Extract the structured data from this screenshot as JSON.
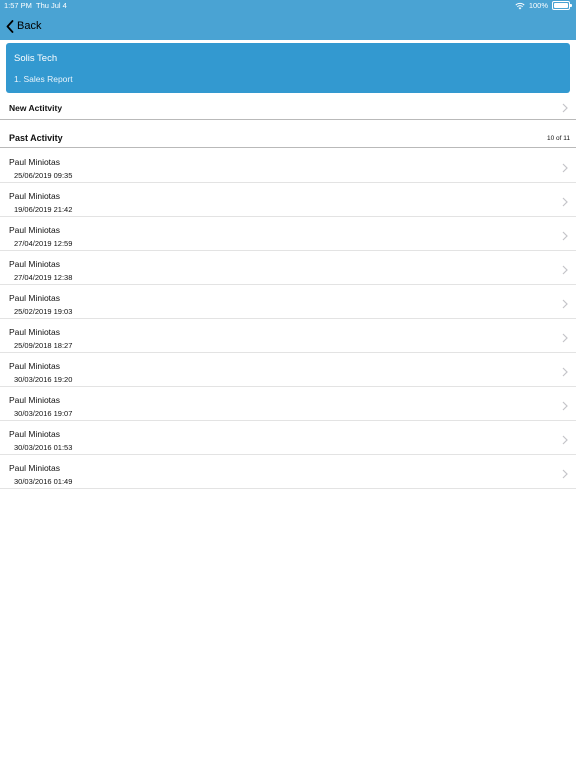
{
  "status_bar": {
    "time": "1:57 PM",
    "date": "Thu Jul 4",
    "battery": "100%"
  },
  "nav": {
    "back_label": "Back"
  },
  "header": {
    "company": "Solis Tech",
    "report": "1. Sales Report"
  },
  "new_activity": {
    "label": "New Actitvity"
  },
  "past_activity": {
    "label": "Past Activity",
    "count": "10 of 11"
  },
  "activities": [
    {
      "name": "Paul Miniotas",
      "date": "25/06/2019 09:35"
    },
    {
      "name": "Paul Miniotas",
      "date": "19/06/2019 21:42"
    },
    {
      "name": "Paul Miniotas",
      "date": "27/04/2019 12:59"
    },
    {
      "name": "Paul Miniotas",
      "date": "27/04/2019 12:38"
    },
    {
      "name": "Paul Miniotas",
      "date": "25/02/2019 19:03"
    },
    {
      "name": "Paul Miniotas",
      "date": "25/09/2018 18:27"
    },
    {
      "name": "Paul Miniotas",
      "date": "30/03/2016 19:20"
    },
    {
      "name": "Paul Miniotas",
      "date": "30/03/2016 19:07"
    },
    {
      "name": "Paul Miniotas",
      "date": "30/03/2016 01:53"
    },
    {
      "name": "Paul Miniotas",
      "date": "30/03/2016 01:49"
    }
  ],
  "colors": {
    "nav_bar": "#4aa3d3",
    "header_card": "#3399d0",
    "chevron": "#c4c4c9"
  }
}
